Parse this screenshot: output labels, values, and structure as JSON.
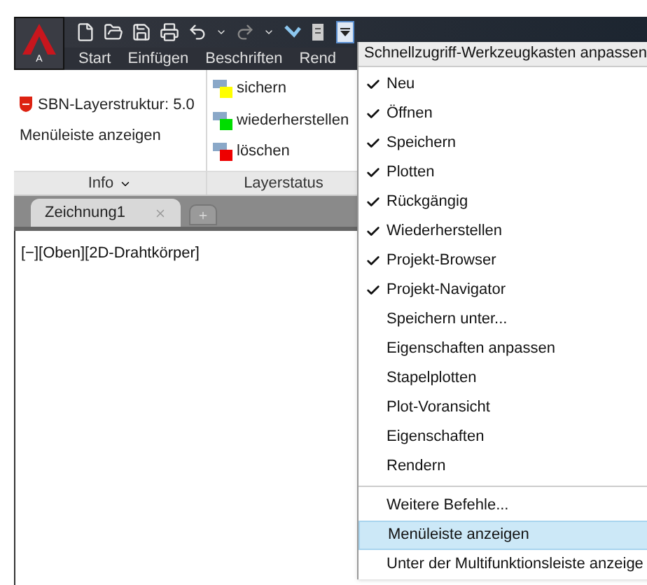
{
  "app_button": {
    "letter": "A"
  },
  "ribbon_tabs": [
    {
      "label": "Start"
    },
    {
      "label": "Einfügen"
    },
    {
      "label": "Beschriften"
    },
    {
      "label": "Rend"
    }
  ],
  "panels": [
    {
      "kind": "info",
      "title": "Info",
      "items": [
        "SBN-Layerstruktur: 5.0",
        "Menüleiste anzeigen"
      ]
    },
    {
      "kind": "layers",
      "title": "Layerstatus",
      "items": [
        {
          "label": "sichern",
          "color": "#ffff00"
        },
        {
          "label": "wiederherstellen",
          "color": "#00dd00"
        },
        {
          "label": "löschen",
          "color": "#ee0000"
        }
      ]
    }
  ],
  "document_tabs": [
    {
      "label": "Zeichnung1",
      "selected": true
    }
  ],
  "viewport_label": "[−][Oben][2D-Drahtkörper]",
  "menu": {
    "title": "Schnellzugriff-Werkzeugkasten anpassen",
    "sections": [
      [
        {
          "label": "Neu",
          "checked": true,
          "selected": false
        },
        {
          "label": "Öffnen",
          "checked": true,
          "selected": false
        },
        {
          "label": "Speichern",
          "checked": true,
          "selected": false
        },
        {
          "label": "Plotten",
          "checked": true,
          "selected": false
        },
        {
          "label": "Rückgängig",
          "checked": true,
          "selected": false
        },
        {
          "label": "Wiederherstellen",
          "checked": true,
          "selected": false
        },
        {
          "label": "Projekt-Browser",
          "checked": true,
          "selected": false
        },
        {
          "label": "Projekt-Navigator",
          "checked": true,
          "selected": false
        },
        {
          "label": "Speichern unter...",
          "checked": false,
          "selected": false
        },
        {
          "label": "Eigenschaften anpassen",
          "checked": false,
          "selected": false
        },
        {
          "label": "Stapelplotten",
          "checked": false,
          "selected": false
        },
        {
          "label": "Plot-Voransicht",
          "checked": false,
          "selected": false
        },
        {
          "label": "Eigenschaften",
          "checked": false,
          "selected": false
        },
        {
          "label": "Rendern",
          "checked": false,
          "selected": false
        }
      ],
      [
        {
          "label": "Weitere Befehle...",
          "checked": false,
          "selected": false
        },
        {
          "label": "Menüleiste anzeigen",
          "checked": false,
          "selected": true
        },
        {
          "label": "Unter der Multifunktionsleiste anzeige",
          "checked": false,
          "selected": false
        }
      ]
    ]
  }
}
